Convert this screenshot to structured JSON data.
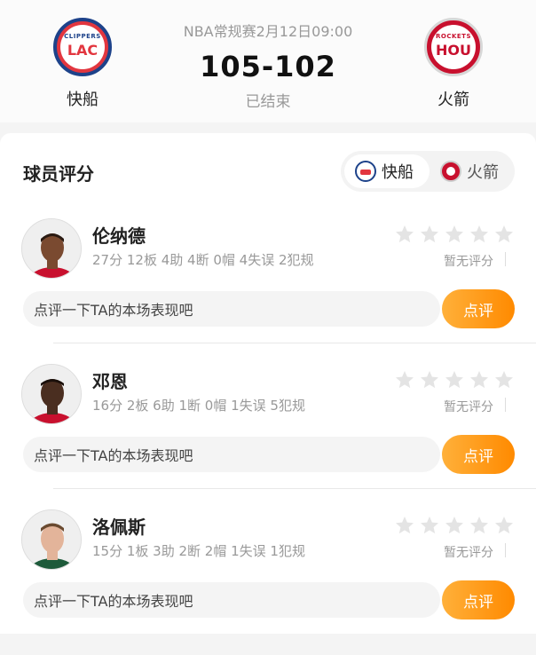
{
  "match": {
    "info": "NBA常规赛2月12日09:00",
    "score": "105-102",
    "status": "已结束",
    "home": {
      "name": "快船",
      "logo_ring": "CLIPPERS",
      "logo_abbr": "LAC",
      "color": "#e2363f",
      "secondary": "#1d428a"
    },
    "away": {
      "name": "火箭",
      "logo_ring": "ROCKETS",
      "logo_abbr": "HOU",
      "color": "#c8102e"
    }
  },
  "ratings": {
    "title": "球员评分",
    "toggle": [
      {
        "label": "快船",
        "active": true,
        "icon": "clippers-logo-icon"
      },
      {
        "label": "火箭",
        "active": false,
        "icon": "rockets-logo-icon"
      }
    ],
    "accent": "#ff8a00",
    "players": [
      {
        "name": "伦纳德",
        "stats": "27分 12板 4助 4断 0帽 4失误 2犯规",
        "rating_text": "暂无评分",
        "comment_placeholder": "点评一下TA的本场表现吧",
        "comment_button": "点评",
        "skin": "#7a4a30",
        "jersey": "#c8102e",
        "stars": 0
      },
      {
        "name": "邓恩",
        "stats": "16分 2板 6助 1断 0帽 1失误 5犯规",
        "rating_text": "暂无评分",
        "comment_placeholder": "点评一下TA的本场表现吧",
        "comment_button": "点评",
        "skin": "#4a2e20",
        "jersey": "#c8102e",
        "stars": 0
      },
      {
        "name": "洛佩斯",
        "stats": "15分 1板 3助 2断 2帽 1失误 1犯规",
        "rating_text": "暂无评分",
        "comment_placeholder": "点评一下TA的本场表现吧",
        "comment_button": "点评",
        "skin": "#e3b49a",
        "jersey": "#1d5a3a",
        "stars": 0
      }
    ]
  }
}
